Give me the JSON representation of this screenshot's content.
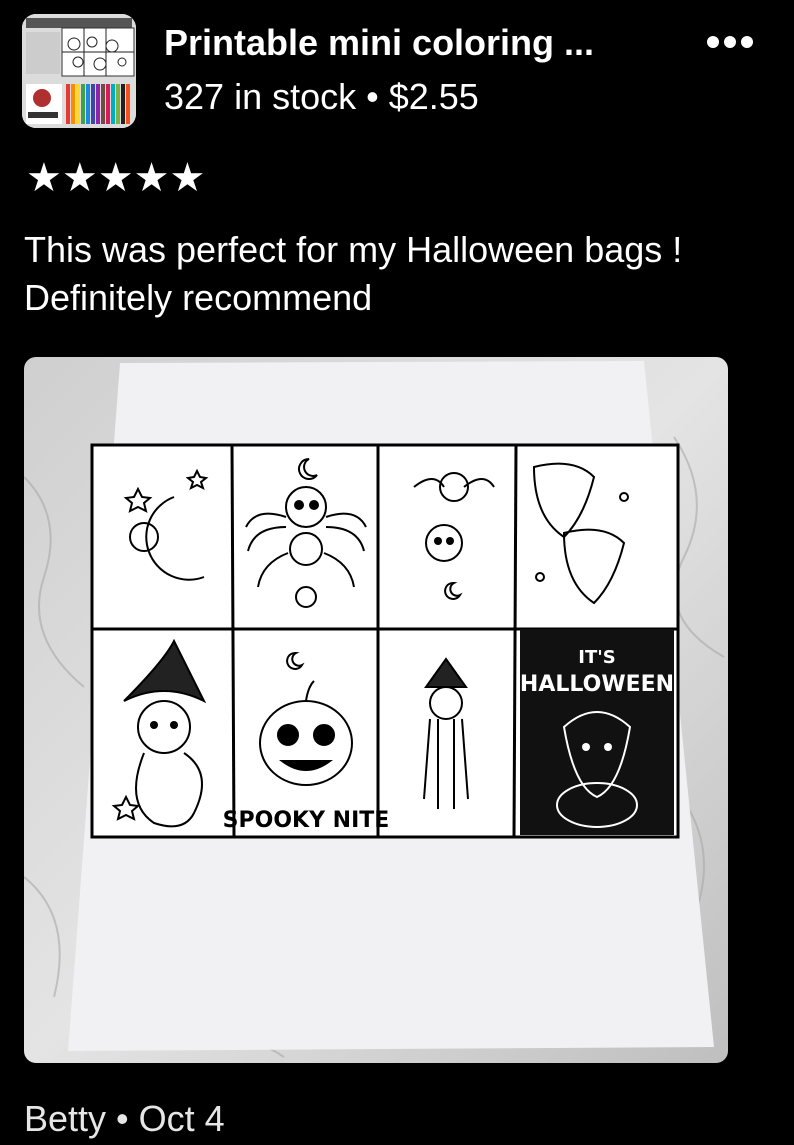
{
  "listing": {
    "title": "Printable mini coloring ...",
    "stock_price": "327 in stock • $2.55",
    "more_icon": "ellipsis-icon"
  },
  "review": {
    "rating": 5,
    "rating_text": "★★★★★",
    "text": "This was perfect for my Halloween bags ! Definitely recommend",
    "photo_text": {
      "its": "IT'S",
      "halloween": "HALLOWEEN",
      "spooky": "SPOOKY NITE"
    }
  },
  "author": {
    "byline": "Betty • Oct 4"
  }
}
